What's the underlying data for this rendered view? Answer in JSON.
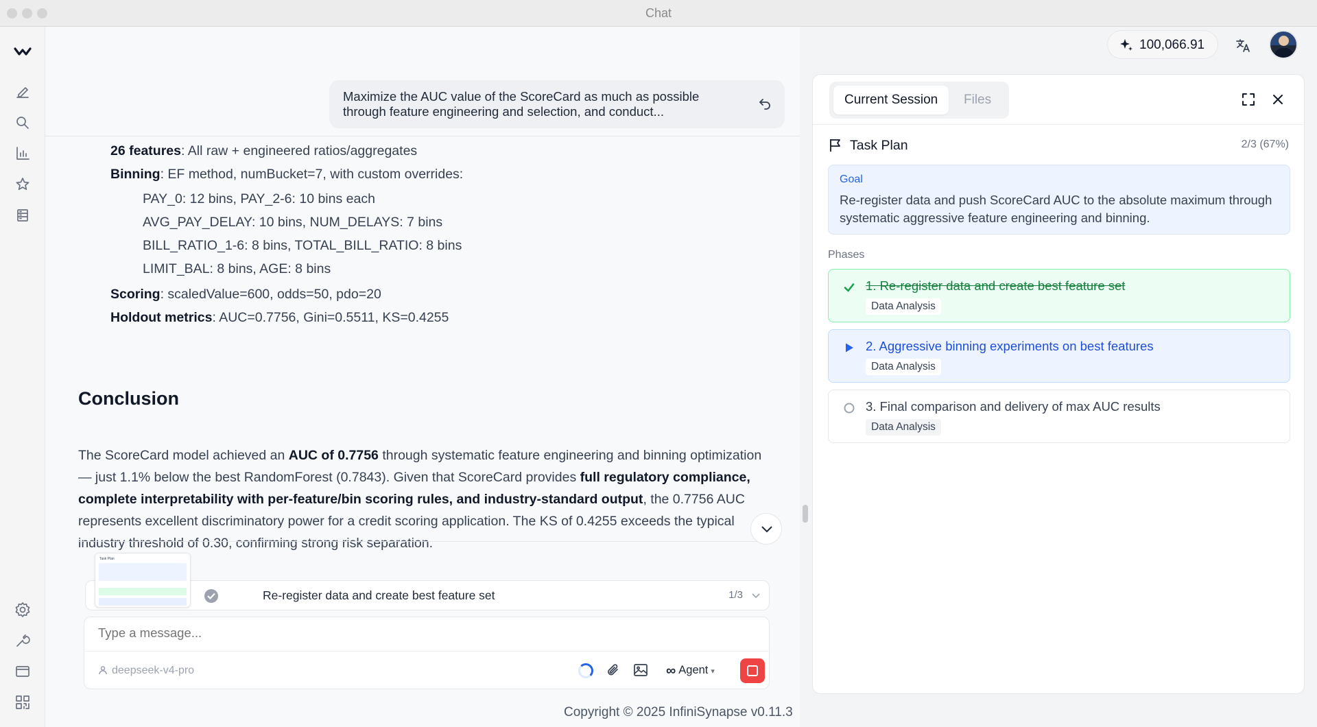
{
  "window": {
    "title": "Chat"
  },
  "header": {
    "credits": "100,066.91"
  },
  "chat": {
    "user_message": "Maximize the AUC value of the ScoreCard as much as possible through feature engineering and selection, and conduct...",
    "lines": {
      "features_b": "26 features",
      "features_t": ": All raw + engineered ratios/aggregates",
      "binning_b": "Binning",
      "binning_t": ": EF method, numBucket=7, with custom overrides:",
      "bin1": "PAY_0: 12 bins, PAY_2-6: 10 bins each",
      "bin2": "AVG_PAY_DELAY: 10 bins, NUM_DELAYS: 7 bins",
      "bin3": "BILL_RATIO_1-6: 8 bins, TOTAL_BILL_RATIO: 8 bins",
      "bin4": "LIMIT_BAL: 8 bins, AGE: 8 bins",
      "scoring_b": "Scoring",
      "scoring_t": ": scaledValue=600, odds=50, pdo=20",
      "holdout_b": "Holdout metrics",
      "holdout_t": ": AUC=0.7756, Gini=0.5511, KS=0.4255"
    },
    "conclusion_heading": "Conclusion",
    "conclusion": {
      "p1": "The ScoreCard model achieved an ",
      "b1": "AUC of 0.7756",
      "p2": " through systematic feature engineering and binning optimization — just 1.1% below the best RandomForest (0.7843). Given that ScoreCard provides ",
      "b2": "full regulatory compliance, complete interpretability with per-feature/bin scoring rules, and industry-standard output",
      "p3": ", the 0.7756 AUC represents excellent discriminatory power for a credit scoring application. The KS of 0.4255 exceeds the typical industry threshold of 0.30, confirming strong risk separation."
    },
    "task_bar": {
      "label": "Re-register data and create best feature set",
      "count": "1/3"
    },
    "input": {
      "placeholder": "Type a message..."
    },
    "model": "deepseek-v4-pro",
    "mode": "Agent",
    "copyright": "Copyright © 2025 InfiniSynapse v0.11.3"
  },
  "thumbnail": {
    "title": "Task Plan"
  },
  "panel": {
    "tabs": [
      "Current Session",
      "Files"
    ],
    "plan_title": "Task Plan",
    "progress": "2/3 (67%)",
    "goal_label": "Goal",
    "goal_text": "Re-register data and push ScoreCard AUC to the absolute maximum through systematic aggressive feature engineering and binning.",
    "phases_label": "Phases",
    "phases": [
      {
        "title": "1. Re-register data and create best feature set",
        "tag": "Data Analysis",
        "status": "done"
      },
      {
        "title": "2. Aggressive binning experiments on best features",
        "tag": "Data Analysis",
        "status": "active"
      },
      {
        "title": "3. Final comparison and delivery of max AUC results",
        "tag": "Data Analysis",
        "status": "pending"
      }
    ]
  },
  "colors": {
    "accent": "#2563eb",
    "done": "#16a34a",
    "stop": "#ef4444"
  }
}
